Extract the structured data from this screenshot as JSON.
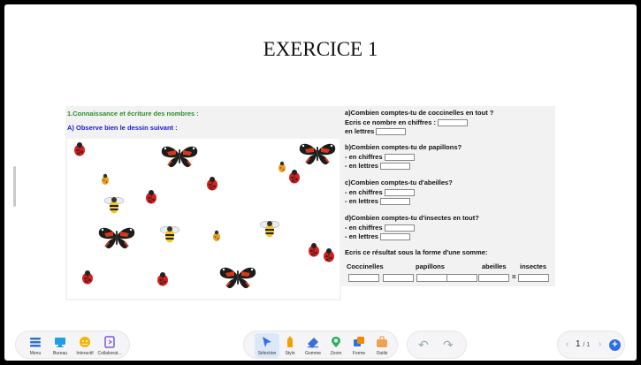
{
  "page": {
    "title": "EXERCICE 1"
  },
  "worksheet": {
    "section_title": "1.Connaissance et écriture des nombres :",
    "subtitle": "A) Observe bien le dessin suivant :",
    "questions": {
      "a_title": "a)Combien comptes-tu de coccinelles en tout ?",
      "a_line1": "Ecris ce nombre en chiffres :",
      "a_line2": "en lettres",
      "b_title": "b)Combien comptes-tu de papillons?",
      "c_title": "c)Combien comptes-tu d'abeilles?",
      "d_title": "d)Combien comptes-tu d'insectes en tout?",
      "en_chiffres": "- en chiffres",
      "en_lettres": "- en lettres"
    },
    "sum_instruction": "Ecris ce résultat sous la forme d'une somme:",
    "sum_labels": [
      "Coccinelles",
      "papillons",
      "abeilles",
      "insectes"
    ],
    "equals": "="
  },
  "toolbar": {
    "left": [
      {
        "label": "Menu",
        "icon": "menu-icon",
        "color": "#2f6fe4"
      },
      {
        "label": "Bureau",
        "icon": "monitor-icon",
        "color": "#1ea0e8"
      },
      {
        "label": "Interactif",
        "icon": "interactive-icon",
        "color": "#f4b400"
      },
      {
        "label": "Collaborat...",
        "icon": "collaboration-icon",
        "color": "#7b5cd6"
      }
    ],
    "middle": [
      {
        "label": "Sélection",
        "icon": "cursor-icon",
        "color": "#2f6fe4",
        "active": true
      },
      {
        "label": "Stylo",
        "icon": "pen-icon",
        "color": "#f4a100"
      },
      {
        "label": "Gomme",
        "icon": "eraser-icon",
        "color": "#3a6fd8"
      },
      {
        "label": "Zoom",
        "icon": "zoom-icon",
        "color": "#2bb35c"
      },
      {
        "label": "Forme",
        "icon": "shape-icon",
        "color": "#f08a00"
      },
      {
        "label": "Outils",
        "icon": "tools-icon",
        "color": "#f0a050"
      }
    ],
    "pager": {
      "current": "1",
      "total": "/ 1"
    }
  }
}
